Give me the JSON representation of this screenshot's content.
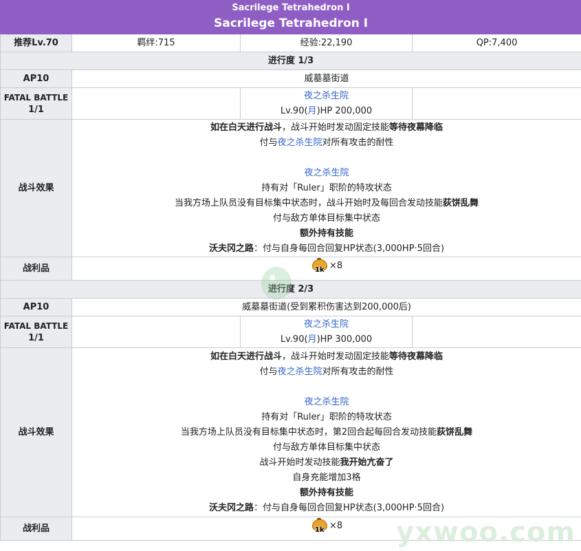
{
  "header": {
    "title_small": "Sacrilege Tetrahedron Ⅰ",
    "title_large": "Sacrilege Tetrahedron Ⅰ"
  },
  "info": {
    "recommend": "推荐Lv.70",
    "bond": "羁绊:715",
    "exp": "经验:22,190",
    "qp": "QP:7,400"
  },
  "sections": [
    {
      "progress": "进行度 1/3",
      "ap": "AP10",
      "location": "威墓墓街道",
      "fatal_label_1": "FATAL BATTLE",
      "fatal_label_2": "1/1",
      "enemy_name": "夜之杀生院",
      "enemy_lv_pre": "Lv.90(",
      "enemy_class": "月",
      "enemy_lv_post": ")HP 200,000",
      "effect_label": "战斗效果",
      "effects": {
        "l1_b": "如在白天进行战斗",
        "l1_m": "，战斗开始时发动固定技能",
        "l1_b2": "等待夜幕降临",
        "l2_a": "付与",
        "l2_link": "夜之杀生院",
        "l2_b": "对所有攻击的耐性",
        "l3_link": "夜之杀生院",
        "l4": "持有对「Ruler」职阶的特攻状态",
        "l5_a": "当我方场上队员没有目标集中状态时，战斗开始时及每回合发动技能",
        "l5_b": "荻饼乱舞",
        "l6": "付与敌方单体目标集中状态",
        "l7": "额外持有技能",
        "l8_b": "沃夫冈之路",
        "l8_a": "：付与自身每回合回复HP状态(3,000HP·5回合)"
      },
      "loot_label": "战利品",
      "loot_qty": "1k",
      "loot_count": "×8"
    },
    {
      "progress": "进行度 2/3",
      "ap": "AP10",
      "location": "威墓墓街道(受到累积伤害达到200,000后)",
      "fatal_label_1": "FATAL BATTLE",
      "fatal_label_2": "1/1",
      "enemy_name": "夜之杀生院",
      "enemy_lv_pre": "Lv.90(",
      "enemy_class": "月",
      "enemy_lv_post": ")HP 300,000",
      "effect_label": "战斗效果",
      "effects": {
        "l1_b": "如在白天进行战斗",
        "l1_m": "，战斗开始时发动固定技能",
        "l1_b2": "等待夜幕降临",
        "l2_a": "付与",
        "l2_link": "夜之杀生院",
        "l2_b": "对所有攻击的耐性",
        "l3_link": "夜之杀生院",
        "l4": "持有对「Ruler」职阶的特攻状态",
        "l5_a": "当我方场上队员没有目标集中状态时，第2回合起每回合发动技能",
        "l5_b": "荻饼乱舞",
        "l6": "付与敌方单体目标集中状态",
        "l7_a": "战斗开始时发动技能",
        "l7_b": "我开始亢奋了",
        "l8": "自身充能增加3格",
        "l9": "额外持有技能",
        "l10_b": "沃夫冈之路",
        "l10_a": "：付与自身每回合回复HP状态(3,000HP·5回合)"
      },
      "loot_label": "战利品",
      "loot_qty": "1k",
      "loot_count": "×8"
    }
  ],
  "watermark": "yxwoo.com",
  "icons": {
    "loot_item": "bun-item-icon",
    "watermark_logo": "yxwoo-logo-icon"
  }
}
